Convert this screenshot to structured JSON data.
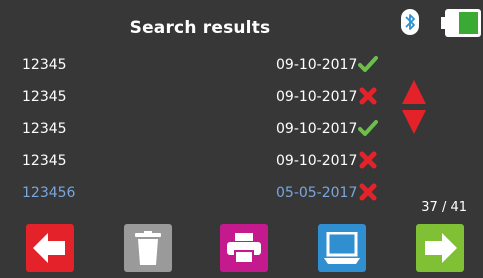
{
  "header": {
    "title": "Search results",
    "bluetooth_icon": "bluetooth-icon",
    "battery_icon": "battery-icon"
  },
  "results": [
    {
      "id": "12345",
      "date": "09-10-2017",
      "status": "pass"
    },
    {
      "id": "12345",
      "date": "09-10-2017",
      "status": "fail"
    },
    {
      "id": "12345",
      "date": "09-10-2017",
      "status": "pass"
    },
    {
      "id": "12345",
      "date": "09-10-2017",
      "status": "fail"
    },
    {
      "id": "123456",
      "date": "05-05-2017",
      "status": "fail",
      "selected": true
    }
  ],
  "pagination": {
    "counter": "37 / 41"
  },
  "toolbar": {
    "buttons": [
      {
        "icon": "arrow-left-icon",
        "color": "#e3222a"
      },
      {
        "icon": "trash-icon",
        "color": "#9a9a9a"
      },
      {
        "icon": "printer-icon",
        "color": "#c51a8d"
      },
      {
        "icon": "computer-icon",
        "color": "#2f8fd1"
      },
      {
        "icon": "arrow-right-icon",
        "color": "#7fc034"
      }
    ]
  },
  "colors": {
    "background": "#373737",
    "pass": "#6cc04a",
    "fail": "#e3222a",
    "selected_text": "#7aa6dd",
    "scroll_arrows": "#e3222a",
    "battery_fill": "#3aaa35"
  }
}
